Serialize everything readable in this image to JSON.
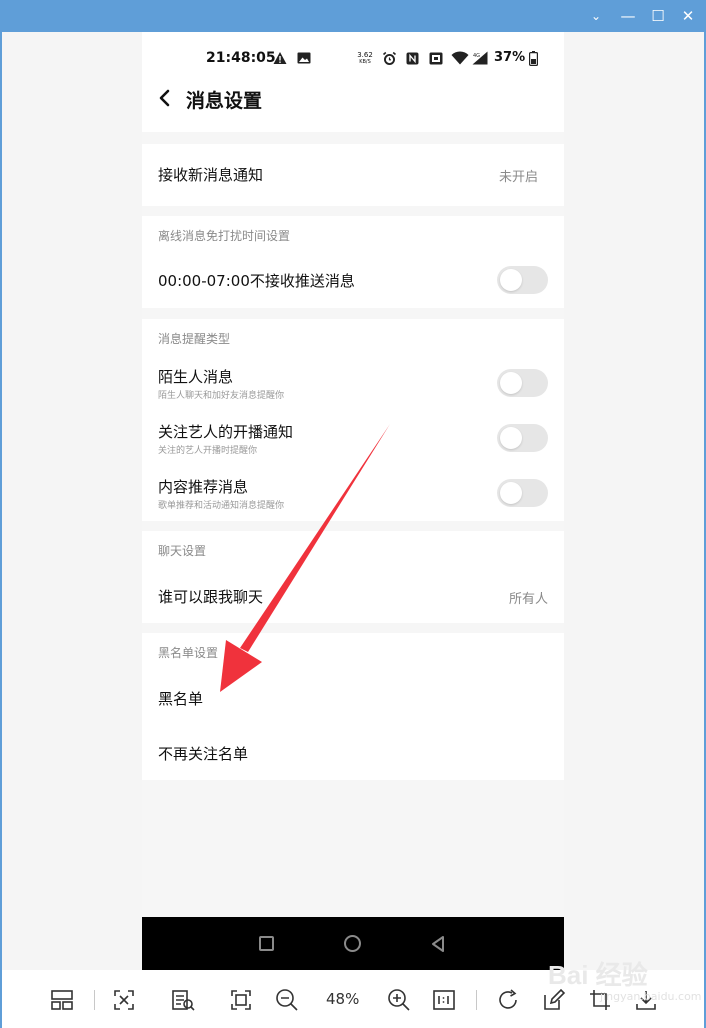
{
  "window": {
    "chevron": "⌄",
    "minimize": "—",
    "maximize": "☐",
    "close": "✕"
  },
  "statusbar": {
    "time": "21:48:05",
    "speed_top": "3.62",
    "speed_bottom": "KB/S",
    "battery": "37%"
  },
  "appbar": {
    "title": "消息设置"
  },
  "sections": {
    "notify": {
      "label": "接收新消息通知",
      "value": "未开启"
    },
    "dnd": {
      "header": "离线消息免打扰时间设置",
      "label": "00:00-07:00不接收推送消息",
      "enabled": false
    },
    "types": {
      "header": "消息提醒类型",
      "items": [
        {
          "title": "陌生人消息",
          "sub": "陌生人聊天和加好友消息提醒你",
          "enabled": false
        },
        {
          "title": "关注艺人的开播通知",
          "sub": "关注的艺人开播时提醒你",
          "enabled": false
        },
        {
          "title": "内容推荐消息",
          "sub": "歌单推荐和活动通知消息提醒你",
          "enabled": false
        }
      ]
    },
    "chat": {
      "header": "聊天设置",
      "label": "谁可以跟我聊天",
      "value": "所有人"
    },
    "blacklist": {
      "header": "黑名单设置",
      "items": [
        "黑名单",
        "不再关注名单"
      ]
    }
  },
  "toolbar": {
    "zoom": "48%"
  },
  "watermark": {
    "text": "Bai 经验",
    "sub": "jingyan.baidu.com"
  },
  "colors": {
    "titlebar": "#5f9ed8",
    "arrow": "#f0323c",
    "toggle_off": "#e6e6e6"
  }
}
